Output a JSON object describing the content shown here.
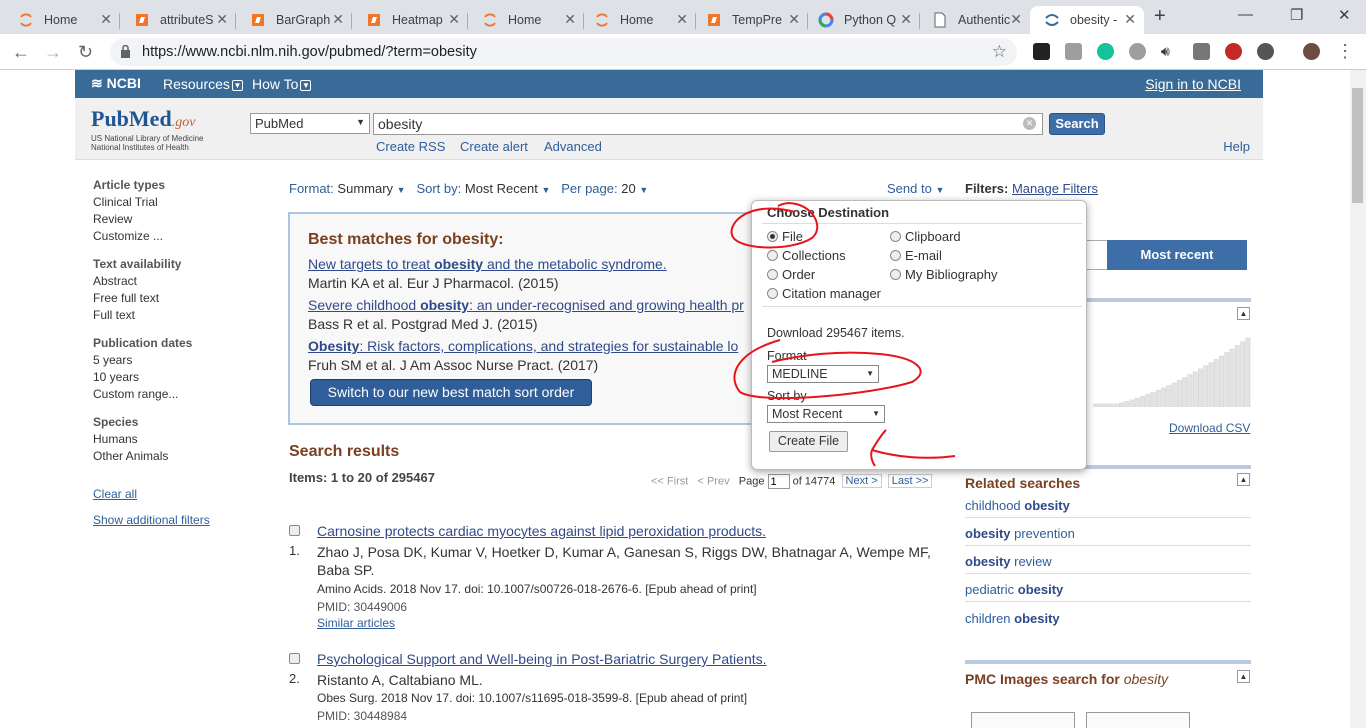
{
  "browser": {
    "tabs": [
      {
        "label": "Home",
        "icon": "jupyter-icon"
      },
      {
        "label": "attributeS",
        "icon": "notebook-icon"
      },
      {
        "label": "BarGraph",
        "icon": "notebook-icon"
      },
      {
        "label": "Heatmap",
        "icon": "notebook-icon"
      },
      {
        "label": "Home",
        "icon": "jupyter-icon"
      },
      {
        "label": "Home",
        "icon": "jupyter-icon"
      },
      {
        "label": "TempPre",
        "icon": "notebook-icon"
      },
      {
        "label": "Python Q",
        "icon": "google-icon"
      },
      {
        "label": "Authentic",
        "icon": "document-icon"
      },
      {
        "label": "obesity -",
        "icon": "ncbi-icon",
        "active": true
      }
    ],
    "url": "https://www.ncbi.nlm.nih.gov/pubmed/?term=obesity"
  },
  "ncbi": {
    "logo": "NCBI",
    "resources": "Resources",
    "howto": "How To",
    "signin": "Sign in to NCBI"
  },
  "search": {
    "logo_main": "PubMed",
    "logo_gov": ".gov",
    "logo_sub1": "US National Library of Medicine",
    "logo_sub2": "National Institutes of Health",
    "db": "PubMed",
    "query": "obesity",
    "button": "Search",
    "links": [
      "Create RSS",
      "Create alert",
      "Advanced"
    ],
    "help": "Help"
  },
  "filters_left": {
    "groups": [
      {
        "head": "Article types",
        "items": [
          "Clinical Trial",
          "Review",
          "Customize ..."
        ]
      },
      {
        "head": "Text availability",
        "items": [
          "Abstract",
          "Free full text",
          "Full text"
        ]
      },
      {
        "head": "Publication dates",
        "items": [
          "5 years",
          "10 years",
          "Custom range..."
        ]
      },
      {
        "head": "Species",
        "items": [
          "Humans",
          "Other Animals"
        ]
      }
    ],
    "clear": "Clear all",
    "show": "Show additional filters"
  },
  "display": {
    "format_label": "Format:",
    "format": "Summary",
    "sort_label": "Sort by:",
    "sort": "Most Recent",
    "perpage_label": "Per page:",
    "perpage": "20",
    "sendto": "Send to",
    "filters_label": "Filters:",
    "manage": "Manage Filters"
  },
  "best": {
    "title": "Best matches for obesity:",
    "items": [
      {
        "pre": "New targets to treat ",
        "kw": "obesity",
        "post": " and the metabolic syndrome.",
        "au": "Martin KA et al. Eur J Pharmacol. (2015)"
      },
      {
        "pre": "Severe childhood ",
        "kw": "obesity",
        "post": ": an under-recognised and growing health pr",
        "au": "Bass R et al. Postgrad Med J. (2015)"
      },
      {
        "pre": "",
        "kw": "Obesity",
        "post": ": Risk factors, complications, and strategies for sustainable lo",
        "au": "Fruh SM et al. J Am Assoc Nurse Pract. (2017)"
      }
    ],
    "switch": "Switch to our new best match sort order"
  },
  "results": {
    "head": "Search results",
    "items_label": "Items: 1 to 20 of 295467",
    "pager": {
      "first": "<< First",
      "prev": "< Prev",
      "page": "Page",
      "cur": "1",
      "of": "of 14774",
      "next": "Next >",
      "last": "Last >>"
    },
    "list": [
      {
        "num": "1.",
        "title": "Carnosine protects cardiac myocytes against lipid peroxidation products.",
        "authors": "Zhao J, Posa DK, Kumar V, Hoetker D, Kumar A, Ganesan S, Riggs DW, Bhatnagar A, Wempe MF, Baba SP.",
        "source": "Amino Acids. 2018 Nov 17. doi: 10.1007/s00726-018-2676-6. [Epub ahead of print]",
        "pmid": "PMID: 30449006",
        "similar": "Similar articles"
      },
      {
        "num": "2.",
        "title": "Psychological Support and Well-being in Post-Bariatric Surgery Patients.",
        "authors": "Ristanto A, Caltabiano ML.",
        "source": "Obes Surg. 2018 Nov 17. doi: 10.1007/s11695-018-3599-8. [Epub ahead of print]",
        "pmid": "PMID: 30448984"
      }
    ]
  },
  "right": {
    "mostrecent": "Most recent",
    "download_csv": "Download CSV",
    "related_head": "Related searches",
    "related": [
      {
        "pre": "childhood ",
        "kw": "obesity",
        "post": ""
      },
      {
        "pre": "",
        "kw": "obesity",
        "post": " prevention"
      },
      {
        "pre": "",
        "kw": "obesity",
        "post": " review"
      },
      {
        "pre": "pediatric ",
        "kw": "obesity",
        "post": ""
      },
      {
        "pre": "children ",
        "kw": "obesity",
        "post": ""
      }
    ],
    "pmc_head": "PMC Images search for ",
    "pmc_kw": "obesity"
  },
  "popup": {
    "title": "Choose Destination",
    "options": [
      "File",
      "Clipboard",
      "Collections",
      "E-mail",
      "Order",
      "My Bibliography",
      "Citation manager"
    ],
    "selected": "File",
    "download": "Download 295467 items.",
    "format_label": "Format",
    "format": "MEDLINE",
    "sort_label": "Sort by",
    "sort": "Most Recent",
    "create": "Create File"
  },
  "colors": {
    "ncbi_bar": "#386b97",
    "link": "#2f4a8a",
    "heading": "#7a4020",
    "annotation": "#e8141b"
  }
}
